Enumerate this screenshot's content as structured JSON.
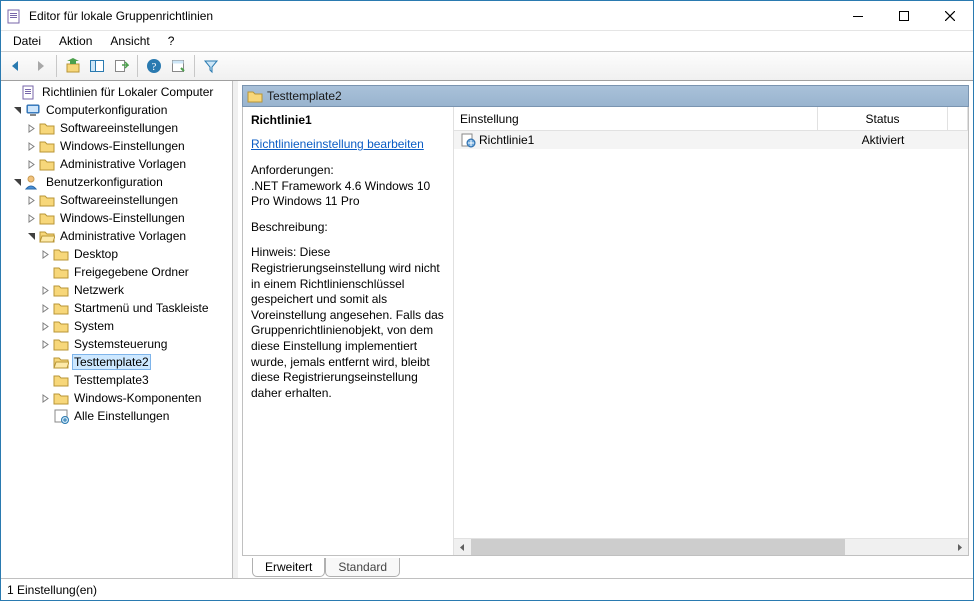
{
  "window": {
    "title": "Editor für lokale Gruppenrichtlinien"
  },
  "menu": {
    "file": "Datei",
    "action": "Aktion",
    "view": "Ansicht",
    "help": "?"
  },
  "tree": {
    "root": "Richtlinien für Lokaler Computer",
    "computer": "Computerkonfiguration",
    "computer_children": [
      "Softwareeinstellungen",
      "Windows-Einstellungen",
      "Administrative Vorlagen"
    ],
    "user": "Benutzerkonfiguration",
    "user_soft": "Softwareeinstellungen",
    "user_win": "Windows-Einstellungen",
    "user_adm": "Administrative Vorlagen",
    "adm_children": [
      "Desktop",
      "Freigegebene Ordner",
      "Netzwerk",
      "Startmenü und Taskleiste",
      "System",
      "Systemsteuerung",
      "Testtemplate2",
      "Testtemplate3",
      "Windows-Komponenten",
      "Alle Einstellungen"
    ]
  },
  "header": {
    "path": "Testtemplate2"
  },
  "details": {
    "name": "Richtlinie1",
    "edit_link": "Richtlinieneinstellung bearbeiten",
    "req_label": "Anforderungen:",
    "req_text": ".NET Framework 4.6 Windows 10 Pro Windows 11 Pro",
    "desc_label": "Beschreibung:",
    "desc_text": "Hinweis: Diese Registrierungseinstellung wird nicht in einem Richtlinienschlüssel gespeichert und somit als Voreinstellung angesehen. Falls das Gruppenrichtlinienobjekt, von dem diese Einstellung implementiert wurde, jemals entfernt wird, bleibt diese Registrierungseinstellung daher erhalten."
  },
  "list_header": {
    "setting": "Einstellung",
    "status": "Status"
  },
  "list_rows": [
    {
      "name": "Richtlinie1",
      "status": "Aktiviert"
    }
  ],
  "tabs": {
    "extended": "Erweitert",
    "standard": "Standard"
  },
  "status": "1 Einstellung(en)"
}
